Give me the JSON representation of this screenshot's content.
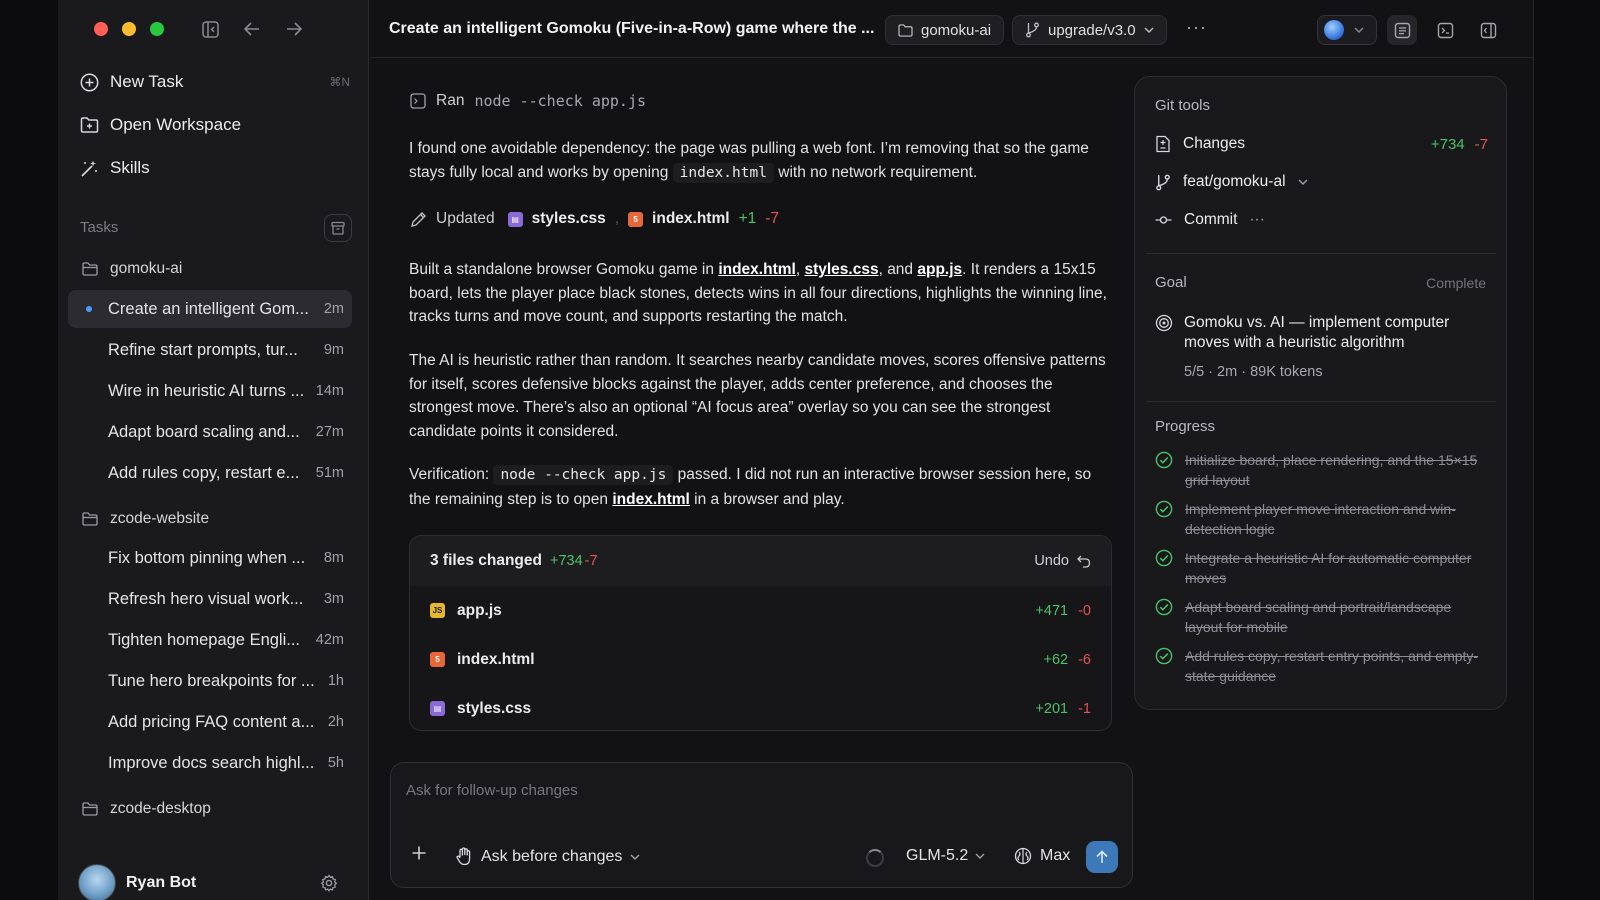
{
  "sidebar": {
    "nav": [
      {
        "label": "New Task",
        "shortcut": "⌘N",
        "icon": "plus-circle-icon"
      },
      {
        "label": "Open Workspace",
        "icon": "folder-plus-icon"
      },
      {
        "label": "Skills",
        "icon": "magic-wand-icon"
      }
    ],
    "tasks_label": "Tasks",
    "folders": [
      {
        "name": "gomoku-ai",
        "tasks": [
          {
            "title": "Create an intelligent Gom...",
            "age": "2m",
            "active": true
          },
          {
            "title": "Refine start prompts, tur...",
            "age": "9m"
          },
          {
            "title": "Wire in heuristic AI turns ...",
            "age": "14m"
          },
          {
            "title": "Adapt board scaling and...",
            "age": "27m"
          },
          {
            "title": "Add rules copy, restart e...",
            "age": "51m"
          }
        ]
      },
      {
        "name": "zcode-website",
        "tasks": [
          {
            "title": "Fix bottom pinning when ...",
            "age": "8m"
          },
          {
            "title": "Refresh hero visual work...",
            "age": "3m"
          },
          {
            "title": "Tighten homepage Engli...",
            "age": "42m"
          },
          {
            "title": "Tune hero breakpoints for ...",
            "age": "1h"
          },
          {
            "title": "Add pricing FAQ content a...",
            "age": "2h"
          },
          {
            "title": "Improve docs search highl...",
            "age": "5h"
          }
        ]
      },
      {
        "name": "zcode-desktop",
        "tasks": []
      }
    ],
    "user": {
      "name": "Ryan Bot"
    }
  },
  "header": {
    "title": "Create an intelligent Gomoku (Five-in-a-Row) game where the ...",
    "workspace_chip": "gomoku-ai",
    "branch_chip": "upgrade/v3.0",
    "more": "···"
  },
  "chat": {
    "ran_label": "Ran",
    "ran_command": "node --check app.js",
    "p1_a": "I found one avoidable dependency: the page was pulling a web font. I’m removing that so the game stays fully local and works by opening ",
    "p1_code": "index.html",
    "p1_b": " with no network requirement.",
    "updated_label": "Updated",
    "updated_files": [
      "styles.css",
      "index.html"
    ],
    "updated_add": "+1",
    "updated_del": "-7",
    "p2_a": "Built a standalone browser Gomoku game in ",
    "p2_l1": "index.html",
    "p2_sep1": ", ",
    "p2_l2": "styles.css",
    "p2_sep2": ", and ",
    "p2_l3": "app.js",
    "p2_b": ". It renders a 15x15 board, lets the player place black stones, detects wins in all four directions, highlights the winning line, tracks turns and move count, and supports restarting the match.",
    "p3": "The AI is heuristic rather than random. It searches nearby candidate moves, scores offensive patterns for itself, scores defensive blocks against the player, adds center preference, and chooses the strongest move. There’s also an optional “AI focus area” overlay so you can see the strongest candidate points it considered.",
    "p4_a": "Verification: ",
    "p4_code": "node --check app.js",
    "p4_b": " passed. I did not run an interactive browser session here, so the remaining step is to open ",
    "p4_link": "index.html",
    "p4_c": " in a browser and play."
  },
  "files_card": {
    "title": "3 files changed",
    "add": "+734",
    "del": "-7",
    "undo": "Undo",
    "files": [
      {
        "name": "app.js",
        "add": "+471",
        "del": "-0",
        "type": "js",
        "color": "#e8b730"
      },
      {
        "name": "index.html",
        "add": "+62",
        "del": "-6",
        "type": "html",
        "color": "#e8673a"
      },
      {
        "name": "styles.css",
        "add": "+201",
        "del": "-1",
        "type": "css",
        "color": "#8a6ad8"
      }
    ]
  },
  "composer": {
    "placeholder": "Ask for follow-up changes",
    "mode": "Ask before changes",
    "model": "GLM-5.2",
    "effort": "Max"
  },
  "git": {
    "title": "Git tools",
    "changes_label": "Changes",
    "changes_add": "+734",
    "changes_del": "-7",
    "branch": "feat/gomoku-al",
    "commit_label": "Commit",
    "commit_more": "···"
  },
  "goal": {
    "title": "Goal",
    "status": "Complete",
    "text": "Gomoku vs. AI — implement computer moves with a heuristic algorithm",
    "meta": "5/5 · 2m · 89K tokens"
  },
  "progress": {
    "title": "Progress",
    "items": [
      "Initialize board, place rendering, and the 15×15 grid layout",
      "Implement player move interaction and win-detection logic",
      "Integrate a heuristic AI for automatic computer moves",
      "Adapt board scaling and portrait/landscape layout for mobile",
      "Add rules copy, restart entry points, and empty-state guidance"
    ]
  },
  "colors": {
    "accent": "#4a9eff",
    "add": "#4cc267",
    "del": "#e55353",
    "send": "#3d79b8"
  }
}
